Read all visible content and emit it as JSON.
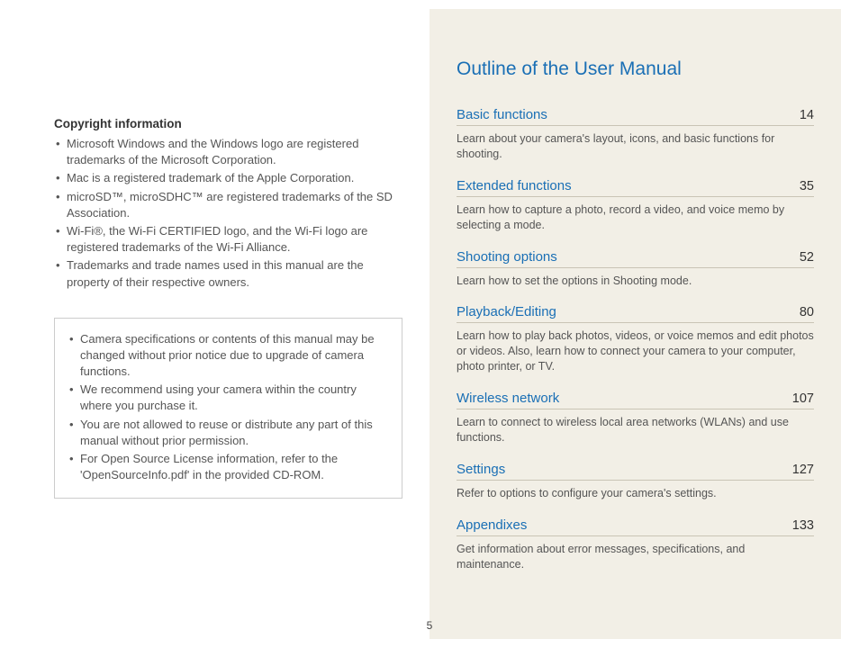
{
  "left": {
    "copyright_heading": "Copyright information",
    "bullets": [
      "Microsoft Windows and the Windows logo are registered trademarks of the Microsoft Corporation.",
      "Mac is a registered trademark of the Apple Corporation.",
      "microSD™, microSDHC™ are registered trademarks of the SD Association.",
      "Wi-Fi®, the Wi-Fi CERTIFIED logo, and the Wi-Fi logo are registered trademarks of the Wi-Fi Alliance.",
      "Trademarks and trade names used in this manual are the property of their respective owners."
    ],
    "notes": [
      "Camera specifications or contents of this manual may be changed without prior notice due to upgrade of camera functions.",
      "We recommend using your camera within the country where you purchase it.",
      "You are not allowed to reuse or distribute any part of this manual without prior permission.",
      "For Open Source License information, refer to the 'OpenSourceInfo.pdf' in the provided CD-ROM."
    ]
  },
  "right": {
    "title": "Outline of the User Manual",
    "items": [
      {
        "name": "Basic functions",
        "page": "14",
        "desc": "Learn about your camera's layout, icons, and basic functions for shooting."
      },
      {
        "name": "Extended functions",
        "page": "35",
        "desc": "Learn how to capture a photo, record a video, and voice memo by selecting a mode."
      },
      {
        "name": "Shooting options",
        "page": "52",
        "desc": "Learn how to set the options in Shooting mode."
      },
      {
        "name": "Playback/Editing",
        "page": "80",
        "desc": "Learn how to play back photos, videos, or voice memos and edit photos or videos. Also, learn how to connect your camera to your computer, photo printer, or TV."
      },
      {
        "name": "Wireless network",
        "page": "107",
        "desc": "Learn to connect to wireless local area networks (WLANs) and use functions."
      },
      {
        "name": "Settings",
        "page": "127",
        "desc": "Refer to options to configure your camera's settings."
      },
      {
        "name": "Appendixes",
        "page": "133",
        "desc": "Get information about error messages, specifications, and maintenance."
      }
    ]
  },
  "page_number": "5"
}
